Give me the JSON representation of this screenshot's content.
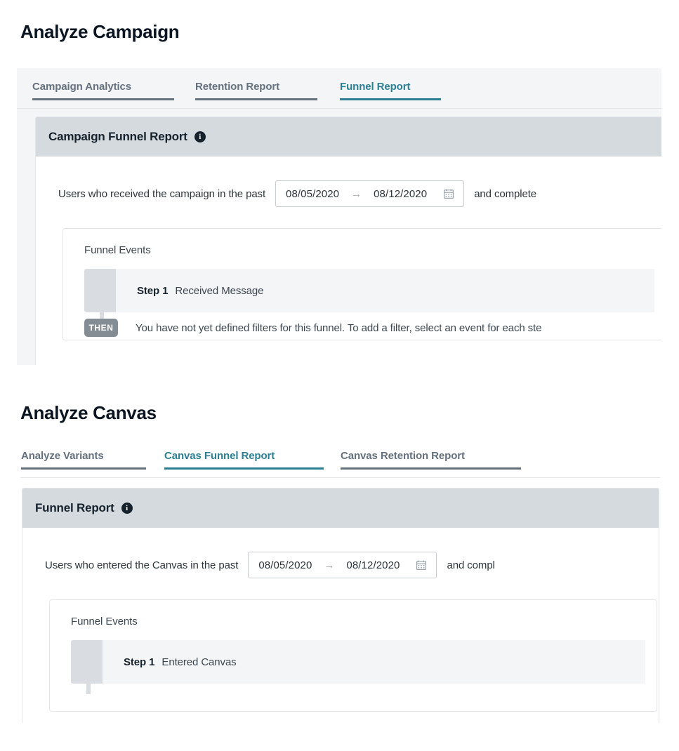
{
  "sections": [
    {
      "heading": "Analyze Campaign",
      "tabs": [
        {
          "label": "Campaign Analytics",
          "active": false
        },
        {
          "label": "Retention Report",
          "active": false
        },
        {
          "label": "Funnel Report",
          "active": true
        }
      ],
      "panel": {
        "title": "Campaign Funnel Report",
        "info_icon": "info-icon",
        "query_prefix": "Users who received the campaign in the past",
        "date_range": {
          "start": "08/05/2020",
          "end": "08/12/2020",
          "arrow_icon": "arrow-right-icon",
          "calendar_icon": "calendar-icon"
        },
        "query_suffix": "and complete",
        "funnel": {
          "label": "Funnel Events",
          "steps": [
            {
              "step_label": "Step 1",
              "event": "Received Message"
            }
          ],
          "then_badge": "THEN",
          "then_text": "You have not yet defined filters for this funnel. To add a filter, select an event for each ste"
        }
      }
    },
    {
      "heading": "Analyze Canvas",
      "tabs": [
        {
          "label": "Analyze Variants",
          "active": false
        },
        {
          "label": "Canvas Funnel Report",
          "active": true
        },
        {
          "label": "Canvas Retention Report",
          "active": false
        }
      ],
      "panel": {
        "title": "Funnel Report",
        "info_icon": "info-icon",
        "query_prefix": "Users who entered the Canvas in the past",
        "date_range": {
          "start": "08/05/2020",
          "end": "08/12/2020",
          "arrow_icon": "arrow-right-icon",
          "calendar_icon": "calendar-icon"
        },
        "query_suffix": "and compl",
        "funnel": {
          "label": "Funnel Events",
          "steps": [
            {
              "step_label": "Step 1",
              "event": "Entered Canvas"
            }
          ],
          "then_badge": "",
          "then_text": ""
        }
      }
    }
  ],
  "colors": {
    "accent_teal": "#2c7f93",
    "tab_inactive": "#64717d",
    "panel_header": "#d5dade",
    "page_bg_shaded": "#f4f5f7",
    "heading": "#0b1521",
    "handle": "#d9dce1",
    "then_badge": "#848c94"
  }
}
